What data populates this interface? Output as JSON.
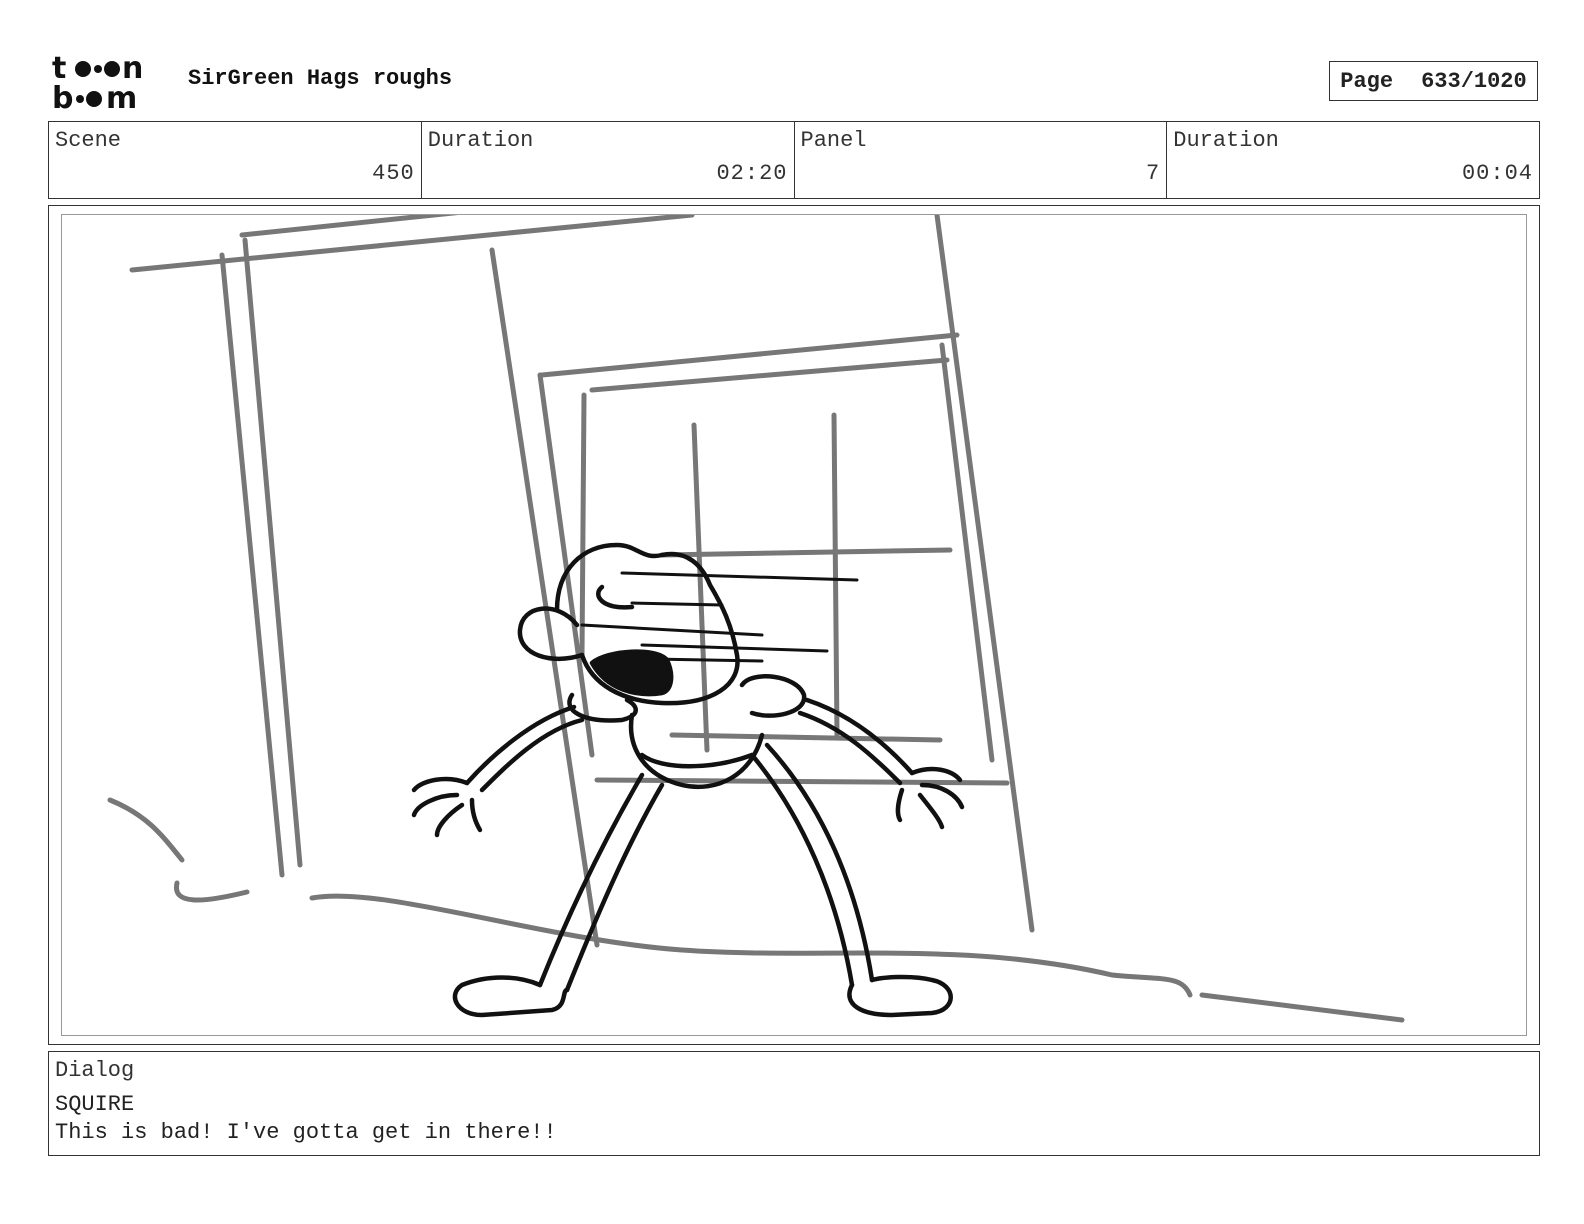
{
  "header": {
    "logo_text": "toonboom",
    "project_title": "SirGreen Hags roughs",
    "page_label": "Page",
    "page_value": "633/1020"
  },
  "info": {
    "scene_label": "Scene",
    "scene_value": "450",
    "scene_duration_label": "Duration",
    "scene_duration_value": "02:20",
    "panel_label": "Panel",
    "panel_value": "7",
    "panel_duration_label": "Duration",
    "panel_duration_value": "00:04"
  },
  "panel": {
    "image": "storyboard-sketch-character-shouting-at-door"
  },
  "dialog": {
    "label": "Dialog",
    "speaker": "SQUIRE",
    "line": "This is bad! I've gotta get in there!!"
  }
}
